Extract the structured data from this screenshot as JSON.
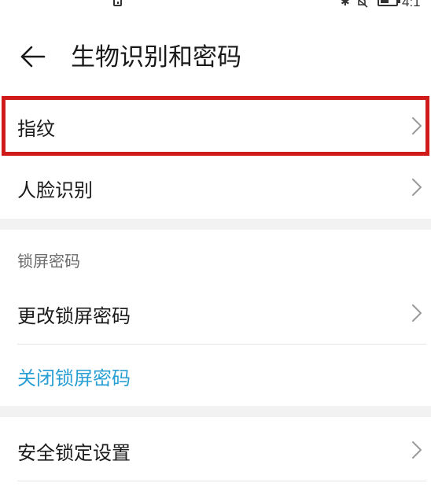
{
  "status_bar": {
    "time": "4:1",
    "icons": [
      "notification-icon",
      "bluetooth-icon",
      "mute-icon",
      "battery-icon"
    ]
  },
  "header": {
    "back_icon": "back-arrow-icon",
    "title": "生物识别和密码"
  },
  "biometrics": {
    "items": [
      {
        "label": "指纹",
        "icon": "chevron-right-icon",
        "highlighted": true
      },
      {
        "label": "人脸识别",
        "icon": "chevron-right-icon"
      }
    ]
  },
  "lock_screen": {
    "section_title": "锁屏密码",
    "change_label": "更改锁屏密码",
    "disable_label": "关闭锁屏密码"
  },
  "security_lock": {
    "label": "安全锁定设置"
  },
  "colors": {
    "highlight": "#d11a1a",
    "link": "#2a9fd3",
    "section_gap": "#f2f2f2"
  }
}
